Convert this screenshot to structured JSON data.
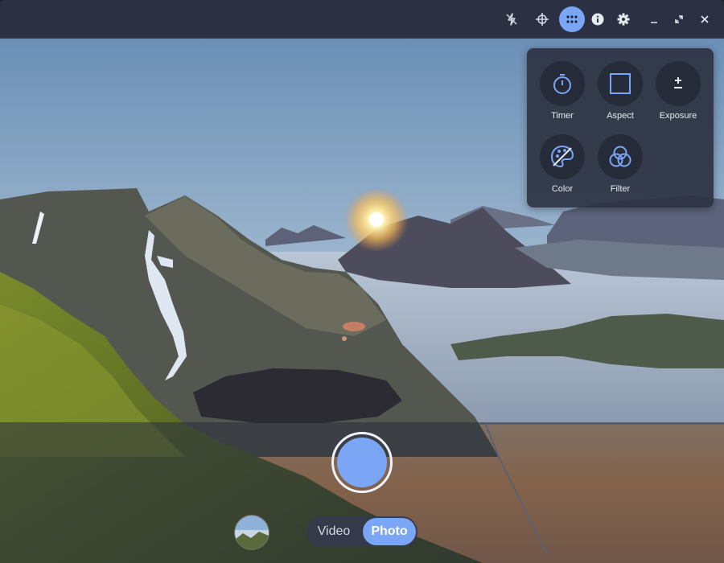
{
  "header": {
    "buttons": [
      {
        "name": "flash-off-icon"
      },
      {
        "name": "crosshair-icon"
      },
      {
        "name": "grid-menu-icon",
        "active": true
      },
      {
        "name": "info-icon"
      },
      {
        "name": "gear-icon"
      }
    ],
    "window_controls": [
      "minimize-icon",
      "maximize-icon",
      "close-icon"
    ]
  },
  "popover": {
    "items": [
      {
        "label": "Timer",
        "icon": "timer-icon"
      },
      {
        "label": "Aspect",
        "icon": "aspect-icon"
      },
      {
        "label": "Exposure",
        "icon": "exposure-icon"
      },
      {
        "label": "Color",
        "icon": "color-palette-icon"
      },
      {
        "label": "Filter",
        "icon": "filter-icon"
      }
    ]
  },
  "bottom": {
    "modes": {
      "video": "Video",
      "photo": "Photo"
    },
    "selected_mode": "Photo"
  },
  "colors": {
    "accent": "#7aa6f5",
    "header_bg": "#2b3143",
    "popover_bg": "#2d3242"
  }
}
